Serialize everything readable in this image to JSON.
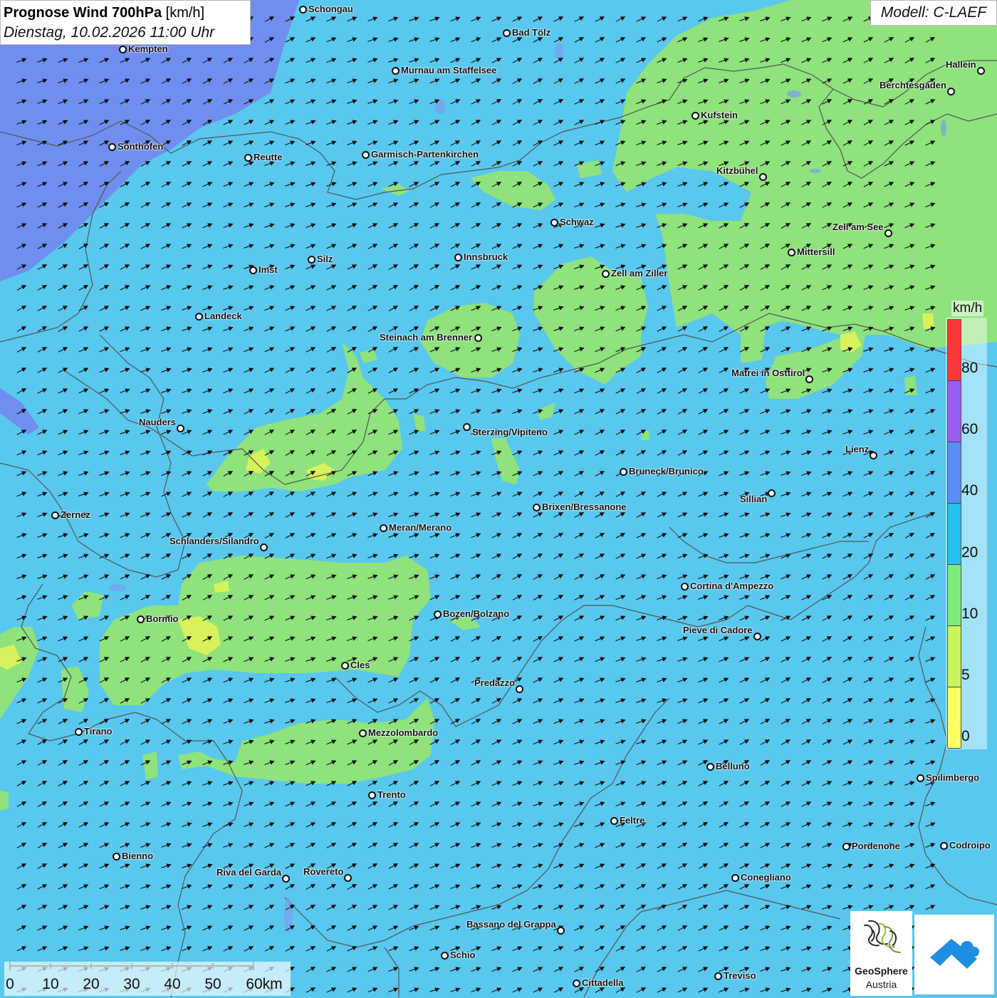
{
  "header": {
    "title_bold": "Prognose Wind 700hPa",
    "title_unit": " [km/h]",
    "datetime": "Dienstag, 10.02.2026 11:00 Uhr"
  },
  "model": "Modell: C-LAEF",
  "legend": {
    "unit": "km/h",
    "ticks": [
      "80",
      "60",
      "40",
      "20",
      "10",
      "5",
      "0"
    ],
    "colors": [
      "#ff3a3a",
      "#9b5cf0",
      "#5a8ef5",
      "#28c0f0",
      "#7dea7a",
      "#c9f55a",
      "#ffff66"
    ]
  },
  "scale": {
    "labels": [
      "0",
      "10",
      "20",
      "30",
      "40",
      "50",
      "60km"
    ]
  },
  "colors": {
    "background": "#58c8ee",
    "wind_10_20": "#8fe27c",
    "wind_20_40": "#58c8ee",
    "wind_40_60": "#6f8ef0",
    "wind_5_10": "#d7f25a",
    "border": "#555555"
  },
  "cities": [
    {
      "name": "Schongau"
    },
    {
      "name": "Bad Tölz"
    },
    {
      "name": "Kempten"
    },
    {
      "name": "Murnau am Staffelsee"
    },
    {
      "name": "Hallein"
    },
    {
      "name": "Berchtesgaden"
    },
    {
      "name": "Kufstein"
    },
    {
      "name": "Sonthofen"
    },
    {
      "name": "Reutte"
    },
    {
      "name": "Garmisch-Partenkirchen"
    },
    {
      "name": "Kitzbühel"
    },
    {
      "name": "Schwaz"
    },
    {
      "name": "Zell am See"
    },
    {
      "name": "Mittersill"
    },
    {
      "name": "Innsbruck"
    },
    {
      "name": "Silz"
    },
    {
      "name": "Imst"
    },
    {
      "name": "Zell am Ziller"
    },
    {
      "name": "Landeck"
    },
    {
      "name": "Steinach am Brenner"
    },
    {
      "name": "Matrei in Osttirol"
    },
    {
      "name": "Nauders"
    },
    {
      "name": "Sterzing/Vipiteno"
    },
    {
      "name": "Lienz"
    },
    {
      "name": "Bruneck/Brunico"
    },
    {
      "name": "Sillian"
    },
    {
      "name": "Zernez"
    },
    {
      "name": "Brixen/Bressanone"
    },
    {
      "name": "Meran/Merano"
    },
    {
      "name": "Schlanders/Silandro"
    },
    {
      "name": "Cortina d'Ampezzo"
    },
    {
      "name": "Bozen/Bolzano"
    },
    {
      "name": "Bormio"
    },
    {
      "name": "Pieve di Cadore"
    },
    {
      "name": "Cles"
    },
    {
      "name": "Predazzo"
    },
    {
      "name": "Tirano"
    },
    {
      "name": "Mezzolombardo"
    },
    {
      "name": "Belluno"
    },
    {
      "name": "Spilimbergo"
    },
    {
      "name": "Trento"
    },
    {
      "name": "Feltre"
    },
    {
      "name": "Pordenone"
    },
    {
      "name": "Codroipo"
    },
    {
      "name": "Bienno"
    },
    {
      "name": "Riva del Garda"
    },
    {
      "name": "Rovereto"
    },
    {
      "name": "Conegliano"
    },
    {
      "name": "Bassano del Grappa"
    },
    {
      "name": "Schio"
    },
    {
      "name": "Treviso"
    },
    {
      "name": "Cittadella"
    }
  ],
  "logo": {
    "line1": "GeoSphere",
    "line2": "Austria"
  }
}
